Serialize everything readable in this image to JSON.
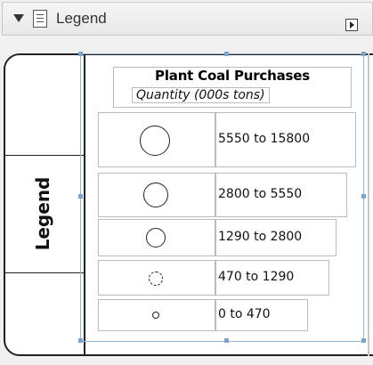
{
  "header": {
    "title": "Legend"
  },
  "side_tab": {
    "label": "Legend"
  },
  "legend": {
    "title": "Plant Coal Purchases",
    "subtitle": "Quantity (000s tons)",
    "rows": [
      {
        "label": "5550 to 15800",
        "symbol": "large-circle-icon"
      },
      {
        "label": "2800 to 5550",
        "symbol": "medium-large-circle-icon"
      },
      {
        "label": "1290 to 2800",
        "symbol": "medium-circle-icon"
      },
      {
        "label": "470 to 1290",
        "symbol": "small-circle-icon"
      },
      {
        "label": "0 to 470",
        "symbol": "tiny-circle-icon"
      }
    ]
  },
  "colors": {
    "frame": "#222222",
    "cell_border": "#bbbbbb",
    "selection": "#7ea3c9"
  }
}
